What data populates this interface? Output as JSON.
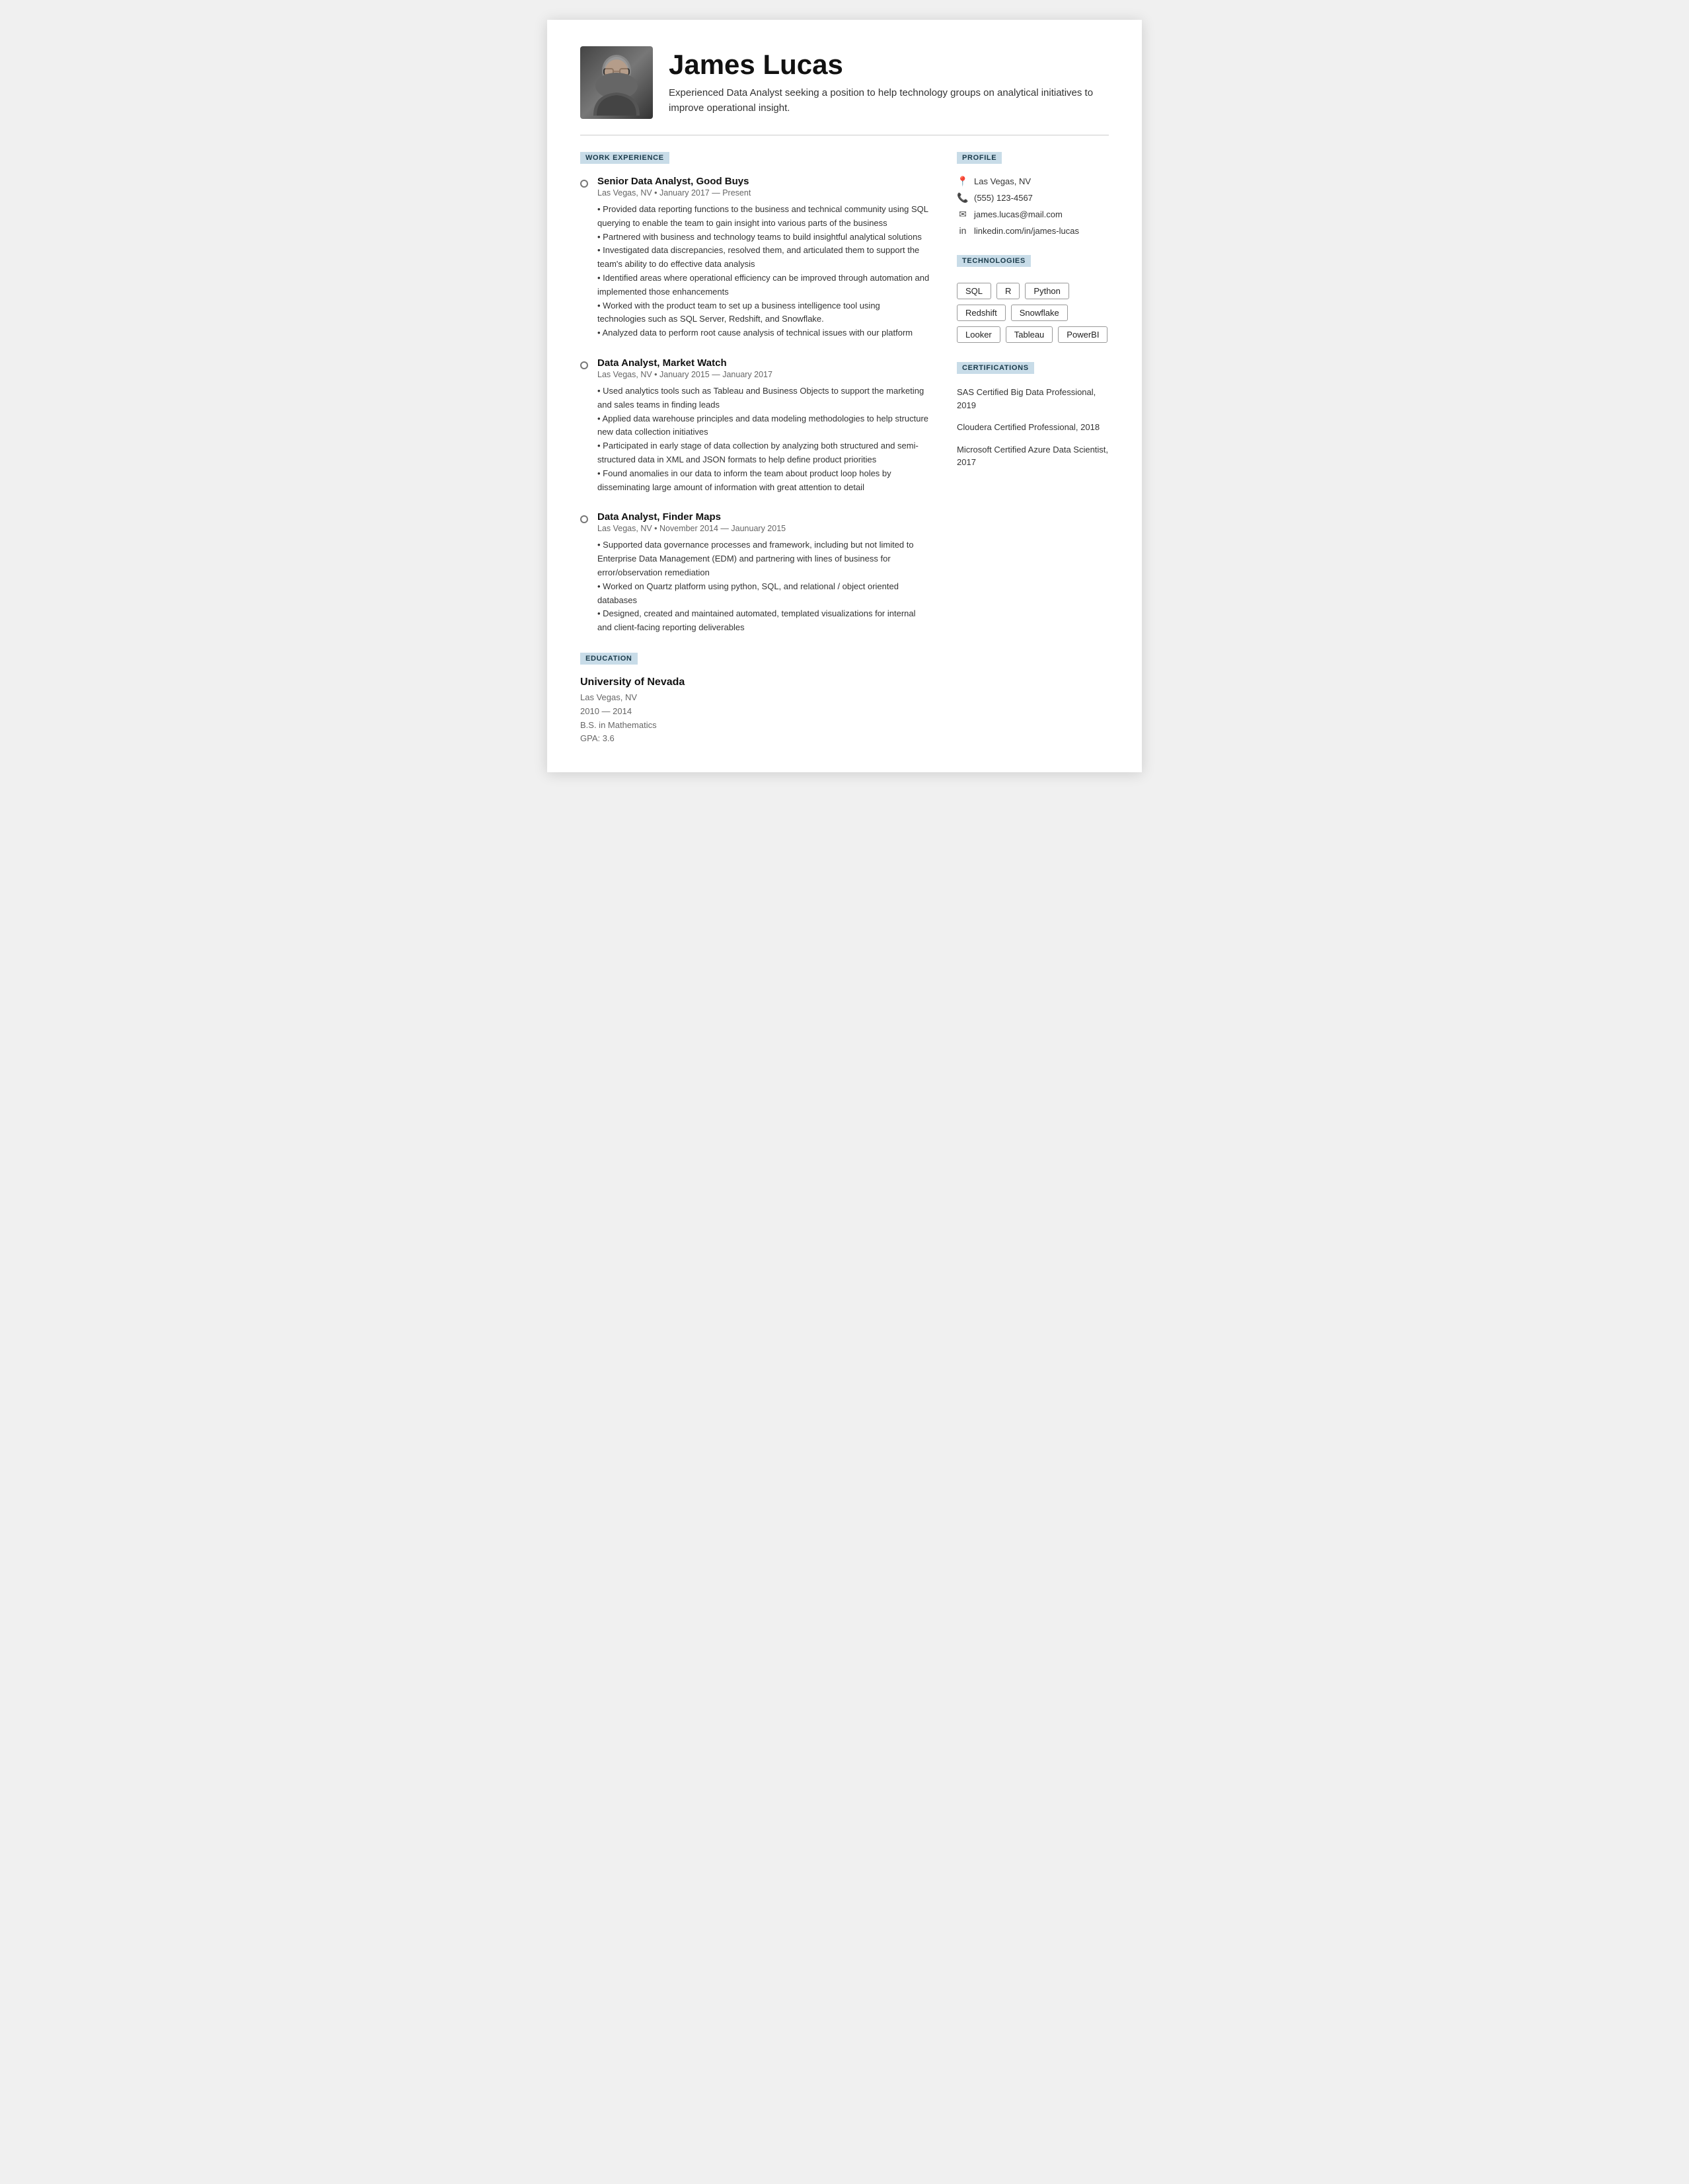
{
  "header": {
    "name": "James Lucas",
    "subtitle": "Experienced Data Analyst seeking a position to help technology groups on analytical initiatives to improve operational insight."
  },
  "sections": {
    "work_experience_label": "WORK EXPERIENCE",
    "education_label": "EDUCATION",
    "profile_label": "PROFILE",
    "technologies_label": "TECHNOLOGIES",
    "certifications_label": "CERTIFICATIONS"
  },
  "jobs": [
    {
      "title": "Senior Data Analyst, Good Buys",
      "meta": "Las Vegas, NV • January 2017 — Present",
      "description": "• Provided data reporting functions to the business and technical community using SQL querying to enable the team to gain insight into various parts of the business\n• Partnered with business and technology teams to build insightful analytical solutions\n• Investigated data discrepancies, resolved them, and articulated them to support the team's ability to do effective data analysis\n• Identified areas where operational efficiency can be improved through automation and implemented those enhancements\n• Worked with the product team to set up a business intelligence tool using technologies such as SQL Server, Redshift, and Snowflake.\n• Analyzed data to perform root cause analysis of technical issues with our platform"
    },
    {
      "title": "Data Analyst, Market Watch",
      "meta": "Las Vegas, NV • January 2015 — January 2017",
      "description": "• Used analytics tools such as Tableau and Business Objects to support the marketing and sales teams in finding leads\n• Applied data warehouse principles and data modeling methodologies to help structure new data collection initiatives\n• Participated in early stage of data collection by analyzing both structured and semi-structured data in XML and JSON formats to help define product priorities\n• Found anomalies in our data to inform the team about product loop holes by disseminating large amount of information with great attention to detail"
    },
    {
      "title": "Data Analyst, Finder Maps",
      "meta": "Las Vegas, NV • November 2014 — Jaunuary 2015",
      "description": "• Supported data governance processes and framework, including but not limited to Enterprise Data Management (EDM) and partnering with lines of business for error/observation remediation\n• Worked on Quartz platform using python, SQL, and relational / object oriented databases\n• Designed, created and maintained automated, templated visualizations for internal and client-facing reporting deliverables"
    }
  ],
  "education": {
    "school": "University of Nevada",
    "city": "Las Vegas, NV",
    "years": "2010 — 2014",
    "degree": "B.S. in Mathematics",
    "gpa": "GPA: 3.6"
  },
  "profile": {
    "location": "Las Vegas, NV",
    "phone": "(555) 123-4567",
    "email": "james.lucas@mail.com",
    "linkedin": "linkedin.com/in/james-lucas"
  },
  "technologies": [
    "SQL",
    "R",
    "Python",
    "Redshift",
    "Snowflake",
    "Looker",
    "Tableau",
    "PowerBI"
  ],
  "certifications": [
    "SAS Certified Big Data Professional, 2019",
    "Cloudera Certified Professional, 2018",
    "Microsoft Certified Azure Data Scientist, 2017"
  ]
}
